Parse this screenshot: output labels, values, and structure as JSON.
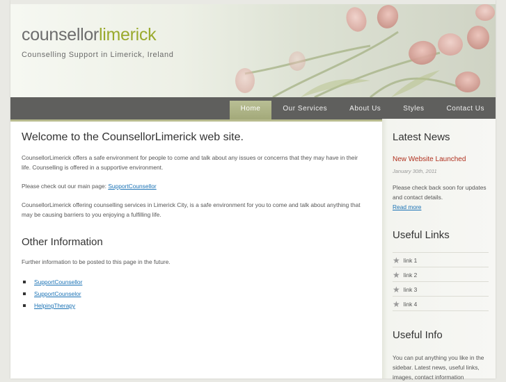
{
  "header": {
    "logo_part1": "counsellor",
    "logo_part2": "limerick",
    "slogan": "Counselling Support in Limerick, Ireland"
  },
  "nav": {
    "items": [
      {
        "label": "Home"
      },
      {
        "label": "Our Services"
      },
      {
        "label": "About Us"
      },
      {
        "label": "Styles"
      },
      {
        "label": "Contact Us"
      }
    ]
  },
  "main": {
    "welcome_heading": "Welcome to the CounsellorLimerick web site.",
    "para1": "CounsellorLimerick offers a safe environment for people to come and talk about any issues or concerns that they may have in their life. Counselling is offered in a supportive environment.",
    "para2_prefix": "Please check out our main page: ",
    "para2_link": "SupportCounsellor",
    "para3": "CounsellorLimerick offering counselling services in Limerick City, is a safe environment for you to come and talk about anything that may be causing barriers to you enjoying a fulfilling life.",
    "other_heading": "Other Information",
    "para4": "Further information to be posted to this page in the future.",
    "links": [
      "SupportCounsellor",
      "SupportCounselor",
      "HelpingTherapy"
    ]
  },
  "sidebar": {
    "news_heading": "Latest News",
    "news_title": "New Website Launched",
    "news_date": "January 30th, 2011",
    "news_text": "Please check back soon for updates and contact details.",
    "news_more": "Read more",
    "links_heading": "Useful Links",
    "links": [
      "link 1",
      "link 2",
      "link 3",
      "link 4"
    ],
    "info_heading": "Useful Info",
    "info_text": "You can put anything you like in the sidebar. Latest news, useful links, images, contact information"
  },
  "colors": {
    "accent": "#9aaa2e",
    "nav_bg": "#5f5f5d",
    "nav_active": "#a3a97a",
    "news_title": "#b0301e",
    "link": "#1a72b5"
  },
  "icons": {
    "link_bullet": "star-icon",
    "list_bullet": "square-bullet-icon"
  }
}
